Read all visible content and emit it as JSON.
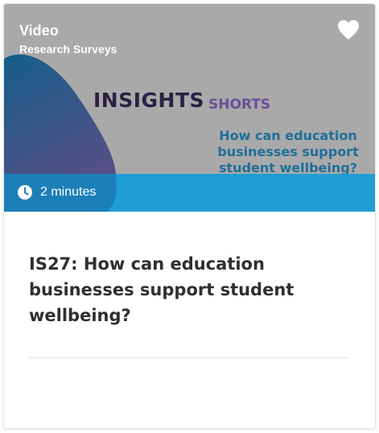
{
  "card": {
    "media_type": "Video",
    "category": "Research Surveys",
    "thumbnail": {
      "brand_main": "INSIGHTS",
      "brand_sub": "SHORTS",
      "question": "How can education businesses support student wellbeing?"
    },
    "duration": "2 minutes",
    "title": "IS27: How can education businesses support student wellbeing?",
    "favorite_icon": "heart-icon",
    "duration_icon": "clock-icon"
  },
  "colors": {
    "thumb_bg": "#a9a9a9",
    "blob_start": "#155f8a",
    "blob_end": "#5a4e86",
    "duration_bar": "#1f9dd3",
    "title_text": "#2f2f2f"
  }
}
